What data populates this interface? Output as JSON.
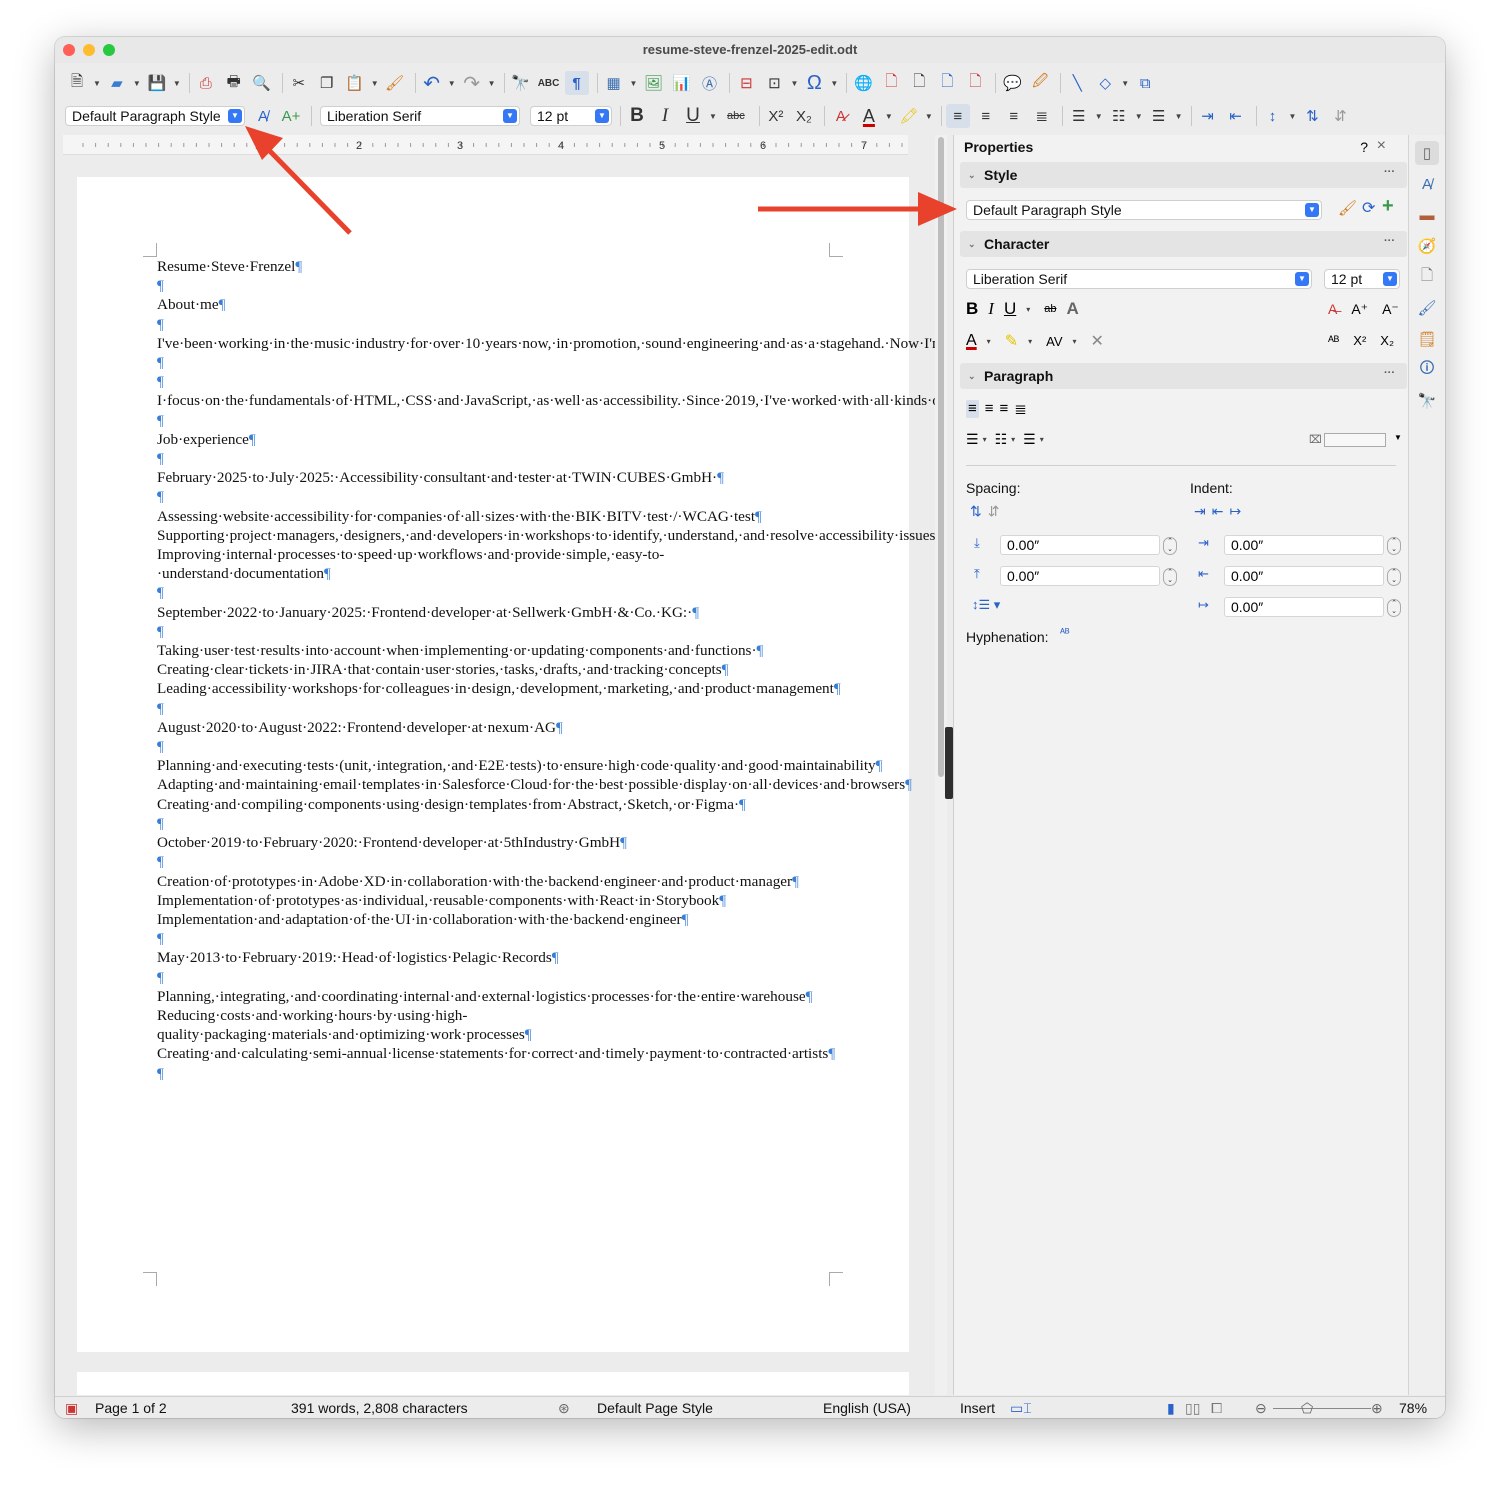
{
  "window": {
    "title": "resume-steve-frenzel-2025-edit.odt"
  },
  "formatting_bar": {
    "paragraph_style": "Default Paragraph Style",
    "font_name": "Liberation Serif",
    "font_size": "12 pt",
    "strikethrough_label": "abc",
    "superscript": "X²",
    "subscript": "X₂"
  },
  "ruler": {
    "ticks": [
      "1",
      "2",
      "3",
      "4",
      "5",
      "6",
      "7"
    ]
  },
  "document": {
    "paragraphs": [
      "Resume·Steve·Frenzel",
      "",
      "About·me",
      "",
      "I've·been·working·in·the·music·industry·for·over·10·years·now,·in·promotion,·sound·engineering·and·as·a·stagehand.·Now·I'm·pursuing·my·other·passion:·developing·websites!",
      "",
      "I·focus·on·the·fundamentals·of·HTML,·CSS·and·JavaScript,·as·well·as·accessibility.·Since·2019,·I've·worked·with·all·kinds·of·companies,·from·small·to·large,·in·different·fields.·I've·worked·both·as·a·permanent·employee·and·as·a·freelancer.",
      "",
      "Job·experience",
      "",
      "February·2025·to·July·2025:·Accessibility·consultant·and·tester·at·TWIN·CUBES·GmbH·",
      "",
      "Assessing·website·accessibility·for·companies·of·all·sizes·with·the·BIK·BITV·test·/·WCAG·test",
      "Supporting·project·managers,·designers,·and·developers·in·workshops·to·identify,·understand,·and·resolve·accessibility·issues",
      "Improving·internal·processes·to·speed·up·workflows·and·provide·simple,·easy-to-·understand·documentation",
      "",
      "September·2022·to·January·2025:·Frontend·developer·at·Sellwerk·GmbH·&·Co.·KG:·",
      "",
      "Taking·user·test·results·into·account·when·implementing·or·updating·components·and·functions·",
      "Creating·clear·tickets·in·JIRA·that·contain·user·stories,·tasks,·drafts,·and·tracking·concepts",
      "Leading·accessibility·workshops·for·colleagues·in·design,·development,·marketing,·and·product·management",
      "",
      "August·2020·to·August·2022:·Frontend·developer·at·nexum·AG",
      "",
      "Planning·and·executing·tests·(unit,·integration,·and·E2E·tests)·to·ensure·high·code·quality·and·good·maintainability",
      "Adapting·and·maintaining·email·templates·in·Salesforce·Cloud·for·the·best·possible·display·on·all·devices·and·browsers",
      "Creating·and·compiling·components·using·design·templates·from·Abstract,·Sketch,·or·Figma·",
      "",
      "October·2019·to·February·2020:·Frontend·developer·at·5thIndustry·GmbH",
      "",
      "Creation·of·prototypes·in·Adobe·XD·in·collaboration·with·the·backend·engineer·and·product·manager",
      "Implementation·of·prototypes·as·individual,·reusable·components·with·React·in·Storybook",
      "Implementation·and·adaptation·of·the·UI·in·collaboration·with·the·backend·engineer",
      "",
      "May·2013·to·February·2019:·Head·of·logistics·Pelagic·Records",
      "",
      "Planning,·integrating,·and·coordinating·internal·and·external·logistics·processes·for·the·entire·warehouse",
      "Reducing·costs·and·working·hours·by·using·high-quality·packaging·materials·and·optimizing·work·processes",
      "Creating·and·calculating·semi-annual·license·statements·for·correct·and·timely·payment·to·contracted·artists",
      ""
    ]
  },
  "sidebar": {
    "title": "Properties",
    "help": "?",
    "close": "×",
    "style_section": {
      "title": "Style",
      "value": "Default Paragraph Style"
    },
    "character_section": {
      "title": "Character",
      "font": "Liberation Serif",
      "size": "12 pt"
    },
    "paragraph_section": {
      "title": "Paragraph",
      "spacing_label": "Spacing:",
      "indent_label": "Indent:",
      "above": "0.00″",
      "below": "0.00″",
      "before_text": "0.00″",
      "after_text": "0.00″",
      "first_line": "0.00″",
      "hyphenation_label": "Hyphenation:"
    }
  },
  "statusbar": {
    "page": "Page 1 of 2",
    "words": "391 words, 2,808 characters",
    "page_style": "Default Page Style",
    "language": "English (USA)",
    "mode": "Insert",
    "zoom": "78%"
  },
  "colors": {
    "accent": "#3478f6",
    "annotation_arrow": "#e8412c",
    "pilcrow": "#3a7fd5"
  }
}
